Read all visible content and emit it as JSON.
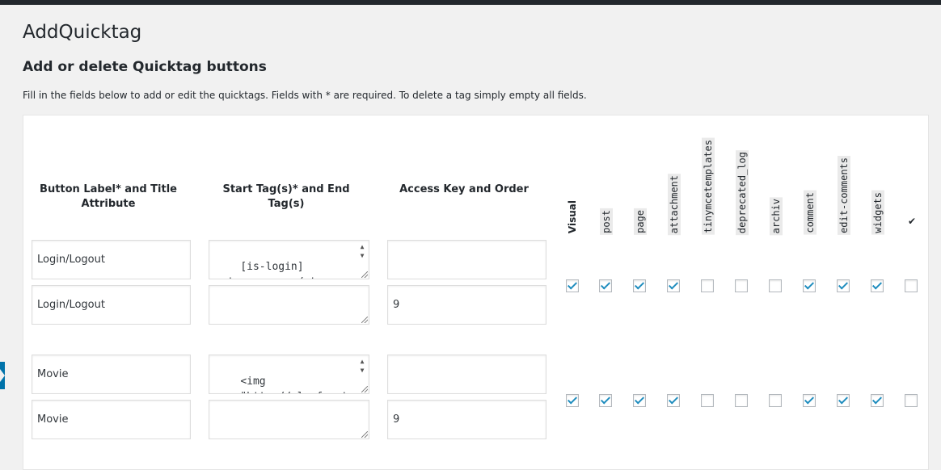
{
  "page": {
    "title": "AddQuicktag",
    "section_title": "Add or delete Quicktag buttons",
    "description": "Fill in the fields below to add or edit the quicktags. Fields with * are required. To delete a tag simply empty all fields."
  },
  "table": {
    "headers": {
      "label": "Button Label* and Title Attribute",
      "tags": "Start Tag(s)* and End Tag(s)",
      "access": "Access Key and Order"
    },
    "vertical_headers": [
      "Visual",
      "post",
      "page",
      "attachment",
      "tinymcetemplates",
      "deprecated_log",
      "archiv",
      "comment",
      "edit-comments",
      "widgets"
    ],
    "checkall_header": "✔",
    "rows": [
      {
        "button_label": "Login/Logout",
        "title_attribute": "Login/Logout",
        "start_tag": "[is-login]\n<strong>++++</strong>\n[/is-login][is-",
        "end_tag": "",
        "access_key": "",
        "order": "9",
        "checks": [
          true,
          true,
          true,
          true,
          false,
          false,
          false,
          true,
          true,
          true,
          false
        ]
      },
      {
        "button_label": "Movie",
        "title_attribute": "Movie",
        "start_tag": "<img\nsrc=\"http://playfront\n.de/...",
        "end_tag": "",
        "access_key": "",
        "order": "9",
        "checks": [
          true,
          true,
          true,
          true,
          false,
          false,
          false,
          true,
          true,
          true,
          false
        ]
      }
    ]
  }
}
